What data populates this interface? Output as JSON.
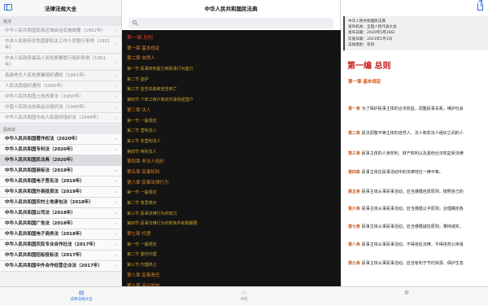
{
  "left": {
    "title": "法律法规大全",
    "section_1": "宪法",
    "rows_1": [
      "中华人民共和国民族区域自治实施纲要（1952年）",
      "中央人民政府任免国家机关工作人员暂行条例（1951年）",
      "中央人民政府最高人民检察署暂行组织条例（1951年）",
      "各级地方人民检察署组织通则（1951年）",
      "人民法庭组织通则（1950年）",
      "中华人民共和国土地改革法（1950年）",
      "中国人民政治协商会议组织法（1949年）",
      "中华人民共和国中央人民政府组织法（1949年）"
    ],
    "section_2": "民商法",
    "rows_2": [
      "中华人民共和国著作权法（2020年）",
      "中华人民共和国专利法（2020年）",
      "中华人民共和国民法典（2020年）",
      "中华人民共和国商标法（2019年）",
      "中华人民共和国电子签名法（2019年）",
      "中华人民共和国外商投资法（2019年）",
      "中华人民共和国农村土地承包法（2018年）",
      "中华人民共和国公司法（2018年）",
      "中华人民共和国广告法（2018年）",
      "中华人民共和国电子商务法（2018年）",
      "中华人民共和国农民专业合作社法（2017年）",
      "中华人民共和国招标投标法（2017年）",
      "中华人民共和国中外合作经营企业法（2017年）"
    ],
    "chevron": "›"
  },
  "middle": {
    "title": "中华人民共和国民法典",
    "toc": [
      {
        "text": "第一编 总则",
        "level": "bian"
      },
      {
        "text": "第一章 基本规定",
        "level": "zhang"
      },
      {
        "text": "第二章 自然人",
        "level": "zhang"
      },
      {
        "text": "第一节 民事权利能力和民事行为能力",
        "level": "jie"
      },
      {
        "text": "第二节 监护",
        "level": "jie"
      },
      {
        "text": "第三节 宣告失踪和宣告死亡",
        "level": "jie"
      },
      {
        "text": "第四节 个体工商户和农村承包经营户",
        "level": "jie"
      },
      {
        "text": "第三章 法人",
        "level": "zhang"
      },
      {
        "text": "第一节 一般规定",
        "level": "jie"
      },
      {
        "text": "第二节 营利法人",
        "level": "jie"
      },
      {
        "text": "第三节 非营利法人",
        "level": "jie"
      },
      {
        "text": "第四节 特别法人",
        "level": "jie"
      },
      {
        "text": "第四章 非法人组织",
        "level": "zhang"
      },
      {
        "text": "第五章 民事权利",
        "level": "zhang"
      },
      {
        "text": "第六章 民事法律行为",
        "level": "zhang"
      },
      {
        "text": "第一节 一般规定",
        "level": "jie"
      },
      {
        "text": "第二节 意思表示",
        "level": "jie"
      },
      {
        "text": "第三节 民事法律行为的效力",
        "level": "jie"
      },
      {
        "text": "第四节 民事法律行为的附条件和附期限",
        "level": "jie"
      },
      {
        "text": "第七章 代理",
        "level": "zhang"
      },
      {
        "text": "第一节 一般规定",
        "level": "jie"
      },
      {
        "text": "第二节 委托代理",
        "level": "jie"
      },
      {
        "text": "第三节 代理终止",
        "level": "jie"
      },
      {
        "text": "第八章 民事责任",
        "level": "zhang"
      },
      {
        "text": "第九章 诉讼时效",
        "level": "zhang"
      }
    ]
  },
  "right": {
    "info": [
      "中华人民共和国民法典",
      "发布机关：全国人民代表大会",
      "发布日期：2020年5月28日",
      "实施日期：2021年1月1日",
      "法规类别：有效"
    ],
    "part_title": "第一编 总则",
    "chapter_title": "第一章 基本规定",
    "articles": [
      {
        "num": "第一条",
        "text": "为了保护民事主体的合法权益，调整民事关系，维护社会"
      },
      {
        "num": "第二条",
        "text": "民法调整平等主体的自然人、法人和非法人组织之间的人"
      },
      {
        "num": "第三条",
        "text": "民事主体的人身权利、财产权利以及其他合法权益受法律"
      },
      {
        "num": "第四条",
        "text": "民事主体在民事活动中的法律地位一律平等。"
      },
      {
        "num": "第五条",
        "text": "民事主体从事民事活动，应当遵循自愿原则，按照自己的"
      },
      {
        "num": "第六条",
        "text": "民事主体从事民事活动，应当遵循公平原则，合理确定各"
      },
      {
        "num": "第七条",
        "text": "民事主体从事民事活动，应当遵循诚信原则，秉持诚实，"
      },
      {
        "num": "第八条",
        "text": "民事主体从事民事活动，不得违反法律，不得违背公序良"
      },
      {
        "num": "第九条",
        "text": "民事主体从事民事活动，应当有利于节约资源、保护生态"
      }
    ]
  },
  "tabbar": {
    "tab1": "法律法规大全",
    "tab2": "书签",
    "tab1_icon": "book-icon",
    "tab2_icon": "star-icon",
    "tab3_icon": "gear-icon"
  },
  "colors": {
    "accent": "#2f6fd6",
    "toc_bg": "#141414",
    "part_red": "#c8201e",
    "chapter_orange": "#d05a1a"
  }
}
